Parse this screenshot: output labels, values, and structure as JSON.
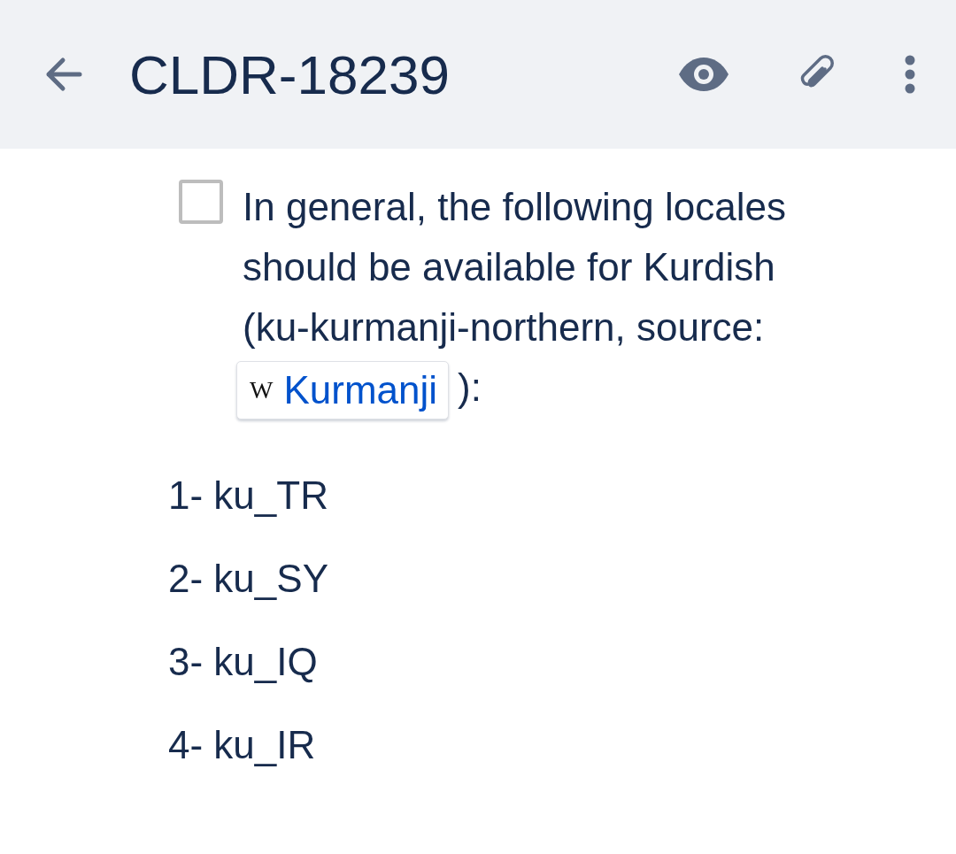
{
  "header": {
    "title": "CLDR-18239"
  },
  "task": {
    "checked": false,
    "text_before": "In general, the following locales should be available for Kurdish (ku-kurmanji-northern, source:",
    "link": {
      "favicon": "W",
      "label": "Kurmanji"
    },
    "text_after": "):"
  },
  "locales": [
    "1- ku_TR",
    "2- ku_SY",
    "3- ku_IQ",
    "4- ku_IR"
  ]
}
